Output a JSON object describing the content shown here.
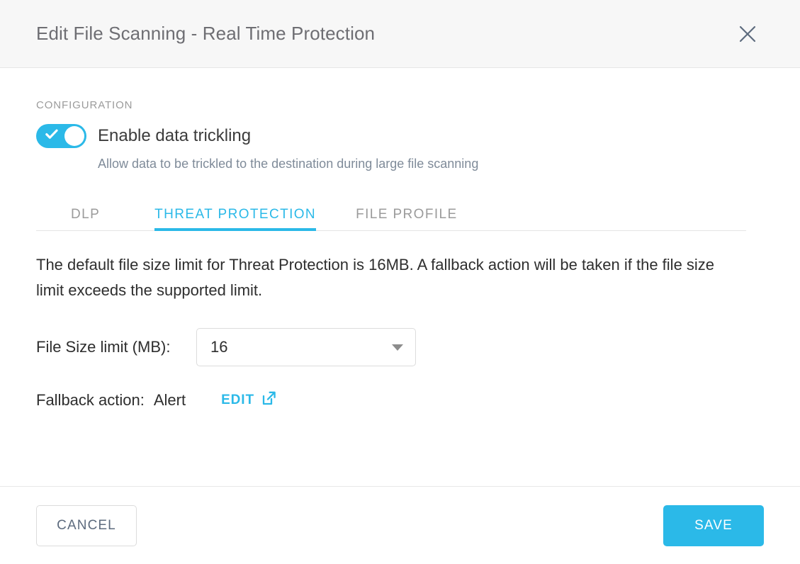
{
  "header": {
    "title": "Edit File Scanning - Real Time Protection",
    "close_icon": "close-icon"
  },
  "configuration": {
    "section_label": "CONFIGURATION",
    "toggle": {
      "label": "Enable data trickling",
      "checked": true,
      "help_text": "Allow data to be trickled to the destination during large file scanning"
    }
  },
  "tabs": [
    {
      "label": "DLP",
      "active": false
    },
    {
      "label": "THREAT PROTECTION",
      "active": true
    },
    {
      "label": "FILE PROFILE",
      "active": false
    }
  ],
  "threat_protection": {
    "description": "The default file size limit for Threat Protection is 16MB. A fallback action will be taken if the file size limit exceeds the supported limit.",
    "file_size_limit": {
      "label": "File Size limit (MB):",
      "value": "16"
    },
    "fallback": {
      "label": "Fallback action:",
      "value": "Alert",
      "edit_label": "EDIT",
      "edit_icon": "external-link-icon"
    }
  },
  "footer": {
    "cancel_label": "CANCEL",
    "save_label": "SAVE"
  },
  "colors": {
    "accent": "#2bb9e8",
    "header_bg": "#f7f7f7",
    "muted_text": "#9b9b9b",
    "help_text": "#7f8b99",
    "body_text": "#2e2e2e",
    "cancel_text": "#5d6b7e"
  }
}
